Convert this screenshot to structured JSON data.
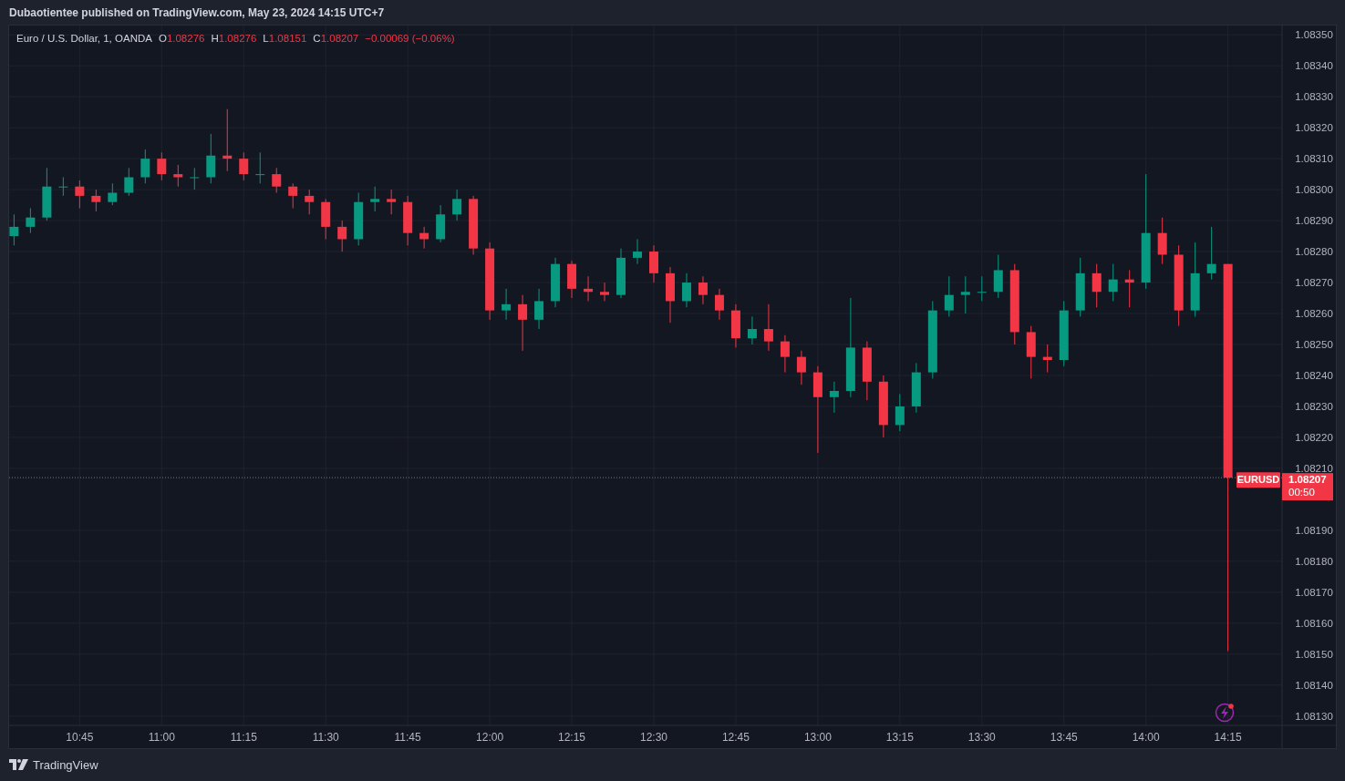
{
  "header": {
    "text": "Dubaotientee published on TradingView.com, May 23, 2024 14:15 UTC+7"
  },
  "legend": {
    "symbol": "Euro / U.S. Dollar, 1, OANDA",
    "fields": [
      {
        "label": "O",
        "value": "1.08276"
      },
      {
        "label": "H",
        "value": "1.08276"
      },
      {
        "label": "L",
        "value": "1.08151"
      },
      {
        "label": "C",
        "value": "1.08207"
      }
    ],
    "change": "−0.00069 (−0.06%)"
  },
  "chart": {
    "chart_data": {
      "type": "candlestick",
      "grid": true,
      "ylim": [
        1.08127,
        1.08353
      ],
      "yticks": [
        {
          "value": 1.0813,
          "label": "1.08130"
        },
        {
          "value": 1.0814,
          "label": "1.08140"
        },
        {
          "value": 1.0815,
          "label": "1.08150"
        },
        {
          "value": 1.0816,
          "label": "1.08160"
        },
        {
          "value": 1.0817,
          "label": "1.08170"
        },
        {
          "value": 1.0818,
          "label": "1.08180"
        },
        {
          "value": 1.0819,
          "label": "1.08190"
        },
        {
          "value": 1.0821,
          "label": "1.08210"
        },
        {
          "value": 1.0822,
          "label": "1.08220"
        },
        {
          "value": 1.0823,
          "label": "1.08230"
        },
        {
          "value": 1.0824,
          "label": "1.08240"
        },
        {
          "value": 1.0825,
          "label": "1.08250"
        },
        {
          "value": 1.0826,
          "label": "1.08260"
        },
        {
          "value": 1.0827,
          "label": "1.08270"
        },
        {
          "value": 1.0828,
          "label": "1.08280"
        },
        {
          "value": 1.0829,
          "label": "1.08290"
        },
        {
          "value": 1.083,
          "label": "1.08300"
        },
        {
          "value": 1.0831,
          "label": "1.08310"
        },
        {
          "value": 1.0832,
          "label": "1.08320"
        },
        {
          "value": 1.0833,
          "label": "1.08330"
        },
        {
          "value": 1.0834,
          "label": "1.08340"
        },
        {
          "value": 1.0835,
          "label": "1.08350"
        }
      ],
      "categories": [
        null,
        null,
        null,
        null,
        "10:45",
        null,
        null,
        null,
        null,
        "11:00",
        null,
        null,
        null,
        null,
        "11:15",
        null,
        null,
        null,
        null,
        "11:30",
        null,
        null,
        null,
        null,
        "11:45",
        null,
        null,
        null,
        null,
        "12:00",
        null,
        null,
        null,
        null,
        "12:15",
        null,
        null,
        null,
        null,
        "12:30",
        null,
        null,
        null,
        null,
        "12:45",
        null,
        null,
        null,
        null,
        "13:00",
        null,
        null,
        null,
        null,
        "13:15",
        null,
        null,
        null,
        null,
        "13:30",
        null,
        null,
        null,
        null,
        "13:45",
        null,
        null,
        null,
        null,
        "14:00",
        null,
        null,
        null,
        null,
        "14:15"
      ],
      "ref_lines": [
        {
          "axis": "y",
          "value": 1.08207
        }
      ],
      "ohlc": [
        [
          1.08285,
          1.08292,
          1.08282,
          1.08288
        ],
        [
          1.08288,
          1.08294,
          1.08286,
          1.08291
        ],
        [
          1.08291,
          1.08307,
          1.0829,
          1.08301
        ],
        [
          1.08301,
          1.08304,
          1.08298,
          1.08301
        ],
        [
          1.08301,
          1.08303,
          1.08294,
          1.08298
        ],
        [
          1.08298,
          1.083,
          1.08293,
          1.08296
        ],
        [
          1.08296,
          1.08302,
          1.08295,
          1.08299
        ],
        [
          1.08299,
          1.08307,
          1.08298,
          1.08304
        ],
        [
          1.08304,
          1.08313,
          1.08302,
          1.0831
        ],
        [
          1.0831,
          1.08312,
          1.08303,
          1.08305
        ],
        [
          1.08305,
          1.08308,
          1.08301,
          1.08304
        ],
        [
          1.08304,
          1.08307,
          1.083,
          1.08304
        ],
        [
          1.08304,
          1.08318,
          1.08302,
          1.08311
        ],
        [
          1.08311,
          1.08326,
          1.08306,
          1.0831
        ],
        [
          1.0831,
          1.08312,
          1.08303,
          1.08305
        ],
        [
          1.08305,
          1.08312,
          1.08302,
          1.08305
        ],
        [
          1.08305,
          1.08307,
          1.08299,
          1.08301
        ],
        [
          1.08301,
          1.08302,
          1.08294,
          1.08298
        ],
        [
          1.08298,
          1.083,
          1.08292,
          1.08296
        ],
        [
          1.08296,
          1.08297,
          1.08284,
          1.08288
        ],
        [
          1.08288,
          1.0829,
          1.0828,
          1.08284
        ],
        [
          1.08284,
          1.08299,
          1.08282,
          1.08296
        ],
        [
          1.08296,
          1.08301,
          1.08293,
          1.08297
        ],
        [
          1.08297,
          1.083,
          1.08292,
          1.08296
        ],
        [
          1.08296,
          1.08298,
          1.08282,
          1.08286
        ],
        [
          1.08286,
          1.08288,
          1.08281,
          1.08284
        ],
        [
          1.08284,
          1.08295,
          1.08283,
          1.08292
        ],
        [
          1.08292,
          1.083,
          1.0829,
          1.08297
        ],
        [
          1.08297,
          1.08298,
          1.08279,
          1.08281
        ],
        [
          1.08281,
          1.08283,
          1.08258,
          1.08261
        ],
        [
          1.08261,
          1.08268,
          1.08258,
          1.08263
        ],
        [
          1.08263,
          1.08266,
          1.08248,
          1.08258
        ],
        [
          1.08258,
          1.08268,
          1.08255,
          1.08264
        ],
        [
          1.08264,
          1.08278,
          1.08262,
          1.08276
        ],
        [
          1.08276,
          1.08277,
          1.08265,
          1.08268
        ],
        [
          1.08268,
          1.08272,
          1.08264,
          1.08267
        ],
        [
          1.08267,
          1.0827,
          1.08264,
          1.08266
        ],
        [
          1.08266,
          1.08281,
          1.08265,
          1.08278
        ],
        [
          1.08278,
          1.08284,
          1.08276,
          1.0828
        ],
        [
          1.0828,
          1.08282,
          1.0827,
          1.08273
        ],
        [
          1.08273,
          1.08275,
          1.08257,
          1.08264
        ],
        [
          1.08264,
          1.08273,
          1.08262,
          1.0827
        ],
        [
          1.0827,
          1.08272,
          1.08263,
          1.08266
        ],
        [
          1.08266,
          1.08268,
          1.08258,
          1.08261
        ],
        [
          1.08261,
          1.08263,
          1.08249,
          1.08252
        ],
        [
          1.08252,
          1.08259,
          1.0825,
          1.08255
        ],
        [
          1.08255,
          1.08263,
          1.08248,
          1.08251
        ],
        [
          1.08251,
          1.08253,
          1.08241,
          1.08246
        ],
        [
          1.08246,
          1.08248,
          1.08237,
          1.08241
        ],
        [
          1.08241,
          1.08243,
          1.08215,
          1.08233
        ],
        [
          1.08233,
          1.08238,
          1.08228,
          1.08235
        ],
        [
          1.08235,
          1.08265,
          1.08233,
          1.08249
        ],
        [
          1.08249,
          1.08251,
          1.08232,
          1.08238
        ],
        [
          1.08238,
          1.0824,
          1.0822,
          1.08224
        ],
        [
          1.08224,
          1.08234,
          1.08222,
          1.0823
        ],
        [
          1.0823,
          1.08244,
          1.08228,
          1.08241
        ],
        [
          1.08241,
          1.08264,
          1.08239,
          1.08261
        ],
        [
          1.08261,
          1.08272,
          1.08259,
          1.08266
        ],
        [
          1.08266,
          1.08272,
          1.0826,
          1.08267
        ],
        [
          1.08267,
          1.08272,
          1.08264,
          1.08267
        ],
        [
          1.08267,
          1.08279,
          1.08265,
          1.08274
        ],
        [
          1.08274,
          1.08276,
          1.0825,
          1.08254
        ],
        [
          1.08254,
          1.08256,
          1.08239,
          1.08246
        ],
        [
          1.08246,
          1.0825,
          1.08241,
          1.08245
        ],
        [
          1.08245,
          1.08264,
          1.08243,
          1.08261
        ],
        [
          1.08261,
          1.08278,
          1.08259,
          1.08273
        ],
        [
          1.08273,
          1.08276,
          1.08262,
          1.08267
        ],
        [
          1.08267,
          1.08276,
          1.08264,
          1.08271
        ],
        [
          1.08271,
          1.08274,
          1.08262,
          1.0827
        ],
        [
          1.0827,
          1.08305,
          1.08268,
          1.08286
        ],
        [
          1.08286,
          1.08291,
          1.08276,
          1.08279
        ],
        [
          1.08279,
          1.08282,
          1.08256,
          1.08261
        ],
        [
          1.08261,
          1.08283,
          1.08259,
          1.08273
        ],
        [
          1.08273,
          1.08288,
          1.08271,
          1.08276
        ],
        [
          1.08276,
          1.08276,
          1.08151,
          1.08207
        ]
      ]
    }
  },
  "price_tag": {
    "symbol": "EURUSD",
    "price": "1.08207",
    "countdown": "00:50"
  },
  "footer": {
    "brand": "TradingView"
  }
}
